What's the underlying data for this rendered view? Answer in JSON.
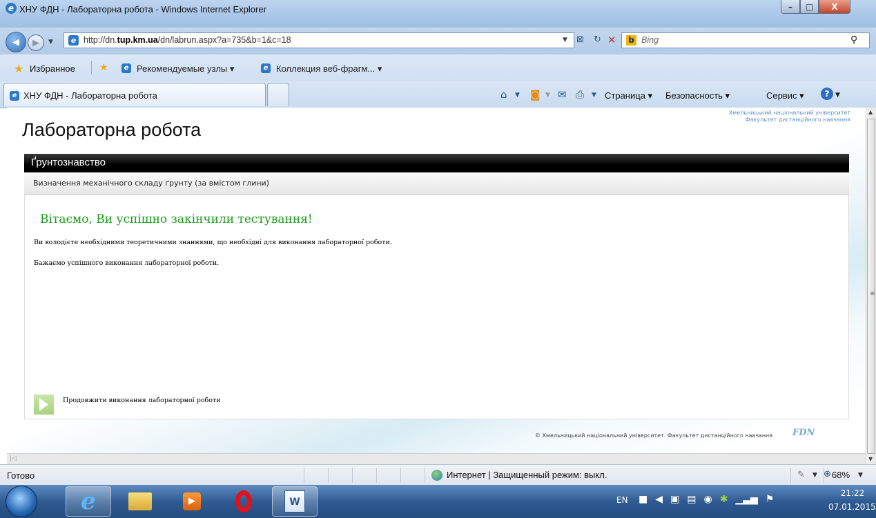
{
  "window": {
    "title": "ХНУ ФДН - Лабораторна робота - Windows Internet Explorer",
    "buttons": {
      "minimize": "–",
      "maximize": "□",
      "close": "X"
    }
  },
  "address_bar": {
    "url_prefix": "http://dn.",
    "url_domain": "tup.km.ua",
    "url_rest": "/dn/labrun.aspx?a=735&b=1&c=18"
  },
  "search": {
    "placeholder": "Bing",
    "logo": "b"
  },
  "favorites_bar": {
    "favorites_label": "Избранное",
    "links": [
      "Рекомендуемые узлы ▾",
      "Коллекция веб-фрагм... ▾"
    ]
  },
  "tab": {
    "title": "ХНУ ФДН - Лабораторна робота"
  },
  "command_bar": {
    "page": "Страница ▾",
    "safety": "Безопасность ▾",
    "tools": "Сервис ▾"
  },
  "page": {
    "university_line1": "Хмельницький національний університет",
    "university_line2": "Факультет дистанційного навчання",
    "title": "Лабораторна робота",
    "subject": "Ґрунтознавство",
    "lab_name": "Визначення механічного складу ґрунту (за вмістом глини)",
    "congrats": "Вітаємо, Ви успішно закінчили тестування!",
    "message1": "Ви володієте необхідними теоретичними знаннями, що необхідні для виконання лабораторної роботи.",
    "message2": "Бажаємо успішного виконання лабораторної роботи.",
    "continue_label": "Продовжити виконання лабораторної роботи",
    "copyright": "© Хмельницький національний університет. Факультет дистанційного навчання",
    "logo_text": "FDN"
  },
  "status_bar": {
    "status": "Готово",
    "zone": "Интернет | Защищенный режим: выкл.",
    "zoom": "68%"
  },
  "taskbar": {
    "language": "EN",
    "time": "21:22",
    "date": "07.01.2015"
  },
  "colors": {
    "congrats_green": "#1a9a1a",
    "subject_bar": "#000000",
    "continue_arrow": "#a9d27f"
  }
}
